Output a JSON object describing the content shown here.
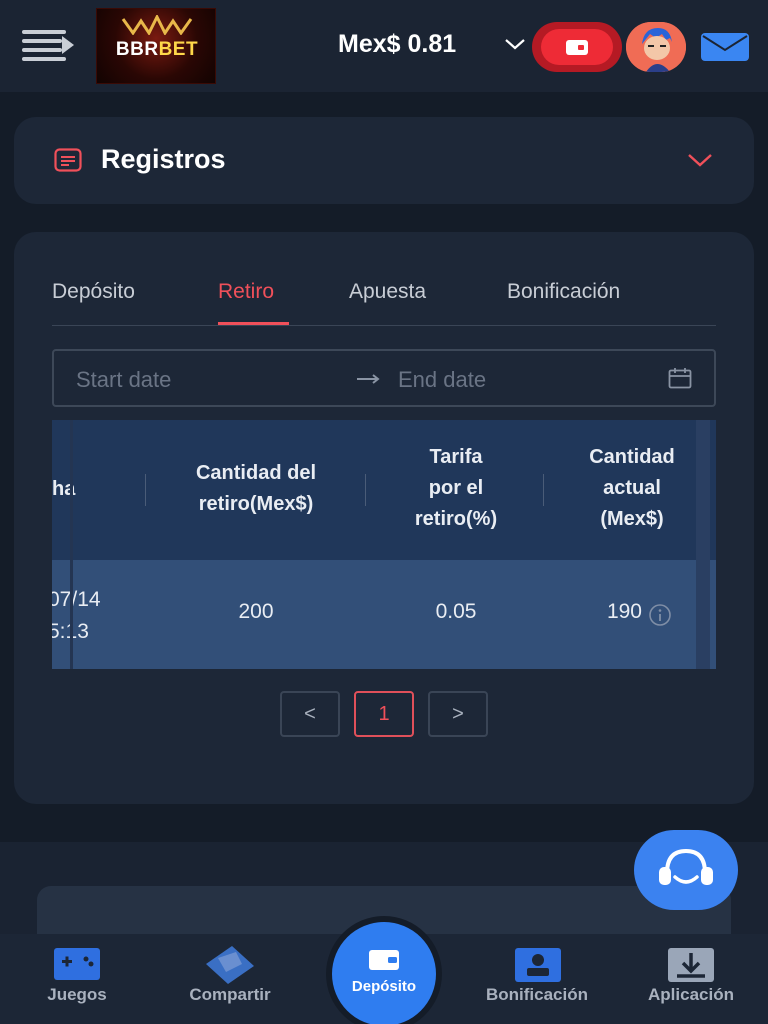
{
  "header": {
    "logo_text_a": "BBR",
    "logo_text_b": "BET",
    "balance": "Mex$ 0.81"
  },
  "registros": {
    "title": "Registros"
  },
  "tabs": [
    {
      "label": "Depósito",
      "active": false
    },
    {
      "label": "Retiro",
      "active": true
    },
    {
      "label": "Apuesta",
      "active": false
    },
    {
      "label": "Bonificación",
      "active": false
    }
  ],
  "date_range": {
    "start_placeholder": "Start date",
    "end_placeholder": "End date"
  },
  "table": {
    "columns": [
      "ha",
      "Cantidad del retiro(Mex$)",
      "Tarifa por el retiro(%)",
      "Cantidad actual (Mex$)"
    ],
    "column_lines": [
      [
        "ha"
      ],
      [
        "Cantidad del",
        "retiro(Mex$)"
      ],
      [
        "Tarifa",
        "por el",
        "retiro(%)"
      ],
      [
        "Cantidad",
        "actual",
        "(Mex$)"
      ]
    ],
    "rows": [
      {
        "date_line1": "07/14",
        "date_line2": "5:13",
        "amount": "200",
        "fee": "0.05",
        "actual": "190"
      }
    ]
  },
  "pagination": {
    "prev": "<",
    "current": "1",
    "next": ">"
  },
  "bottom_nav": {
    "games": "Juegos",
    "share": "Compartir",
    "deposit": "Depósito",
    "bonus": "Bonificación",
    "app": "Aplicación"
  },
  "colors": {
    "accent": "#f0505a",
    "primary_blue": "#2f7df0",
    "background": "#141c28",
    "card": "#1d2737"
  }
}
